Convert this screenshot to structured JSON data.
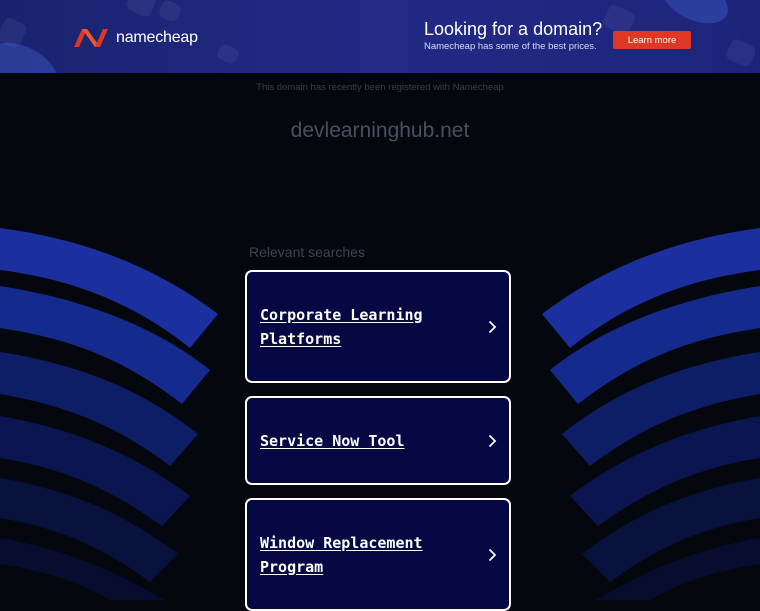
{
  "banner": {
    "logo_text": "namecheap",
    "promo_title": "Looking for a domain?",
    "promo_subtitle": "Namecheap has some of the best prices.",
    "learn_more_label": "Learn more",
    "accent_color": "#de3723",
    "logo_color": "#de3723"
  },
  "page": {
    "registered_notice": "This domain has recently been registered with Namecheap",
    "domain_name": "devlearninghub.net",
    "relevant_heading": "Relevant searches"
  },
  "searches": [
    {
      "line1": "Corporate Learning",
      "line2": "Platforms",
      "icon": "chevron-right-icon"
    },
    {
      "line1": "Service Now Tool",
      "line2": "",
      "icon": "chevron-right-icon"
    },
    {
      "line1": "Window Replacement",
      "line2": "Program",
      "icon": "chevron-right-icon"
    }
  ]
}
